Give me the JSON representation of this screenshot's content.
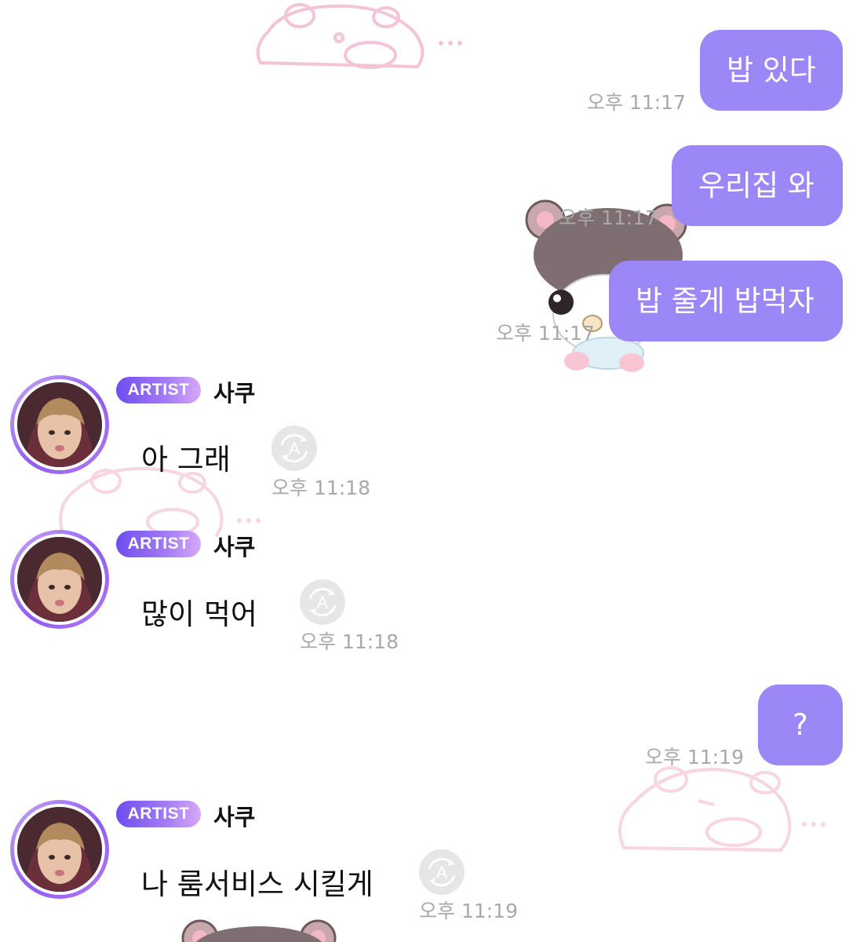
{
  "messages": {
    "out1": {
      "text": "밥 있다",
      "time": "오후 11:17"
    },
    "out2": {
      "text": "우리집 와",
      "time": "오후 11:17"
    },
    "out3": {
      "text": "밥 줄게 밥먹자",
      "time": "오후 11:17"
    },
    "in1": {
      "badge": "ARTIST",
      "sender": "사쿠",
      "text": "아 그래",
      "time": "오후 11:18"
    },
    "in2": {
      "badge": "ARTIST",
      "sender": "사쿠",
      "text": "많이 먹어",
      "time": "오후 11:18"
    },
    "out4": {
      "text": "?",
      "time": "오후 11:19"
    },
    "in3": {
      "badge": "ARTIST",
      "sender": "사쿠",
      "text": "나 룸서비스 시킬게",
      "time": "오후 11:19"
    }
  },
  "colors": {
    "outgoing_bubble": "#9b87f5",
    "badge_start": "#6f4df0",
    "badge_end": "#d7a8f7",
    "timestamp": "#a9a9a9"
  },
  "icons": {
    "translate": "translate-icon",
    "background_sticker": "bear-sticker"
  }
}
